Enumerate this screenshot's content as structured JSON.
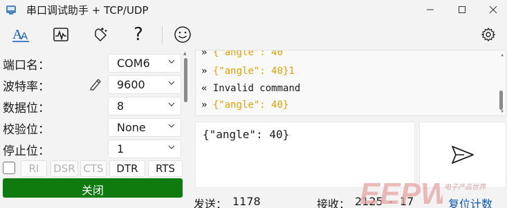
{
  "window": {
    "title": "串口调试助手 + TCP/UDP"
  },
  "toolbar": {
    "help_glyph": "?"
  },
  "settings": {
    "port": {
      "label": "端口名：",
      "value": "COM6"
    },
    "baud": {
      "label": "波特率：",
      "value": "9600"
    },
    "data_bits": {
      "label": "数据位：",
      "value": "8"
    },
    "parity": {
      "label": "校验位：",
      "value": "None"
    },
    "stop_bits": {
      "label": "停止位：",
      "value": "1"
    }
  },
  "signals": [
    "RI",
    "DSR",
    "CTS",
    "DTR",
    "RTS"
  ],
  "close_label": "关闭",
  "receive": {
    "lines": [
      {
        "prefix": "»",
        "text": "{\"angle\": 40"
      },
      {
        "prefix": "»",
        "text": "{\"angle\": 40}1"
      },
      {
        "prefix": "«",
        "text": "Invalid command"
      },
      {
        "prefix": "»",
        "text": "{\"angle\": 40}"
      }
    ]
  },
  "send": {
    "text": "{\"angle\": 40}"
  },
  "status": {
    "sent_label": "发送：",
    "sent_count": "1178",
    "recv_label": "接收：",
    "recv_count": "2125",
    "separator": "-",
    "recv_extra": "17",
    "reset_label": "复位计数"
  },
  "watermark": {
    "logo": "EEPW",
    "sub": "电子产品世界"
  },
  "colors": {
    "json_text": "#e2a100",
    "close_button": "#0f7b0f",
    "link": "#0b57b3"
  }
}
